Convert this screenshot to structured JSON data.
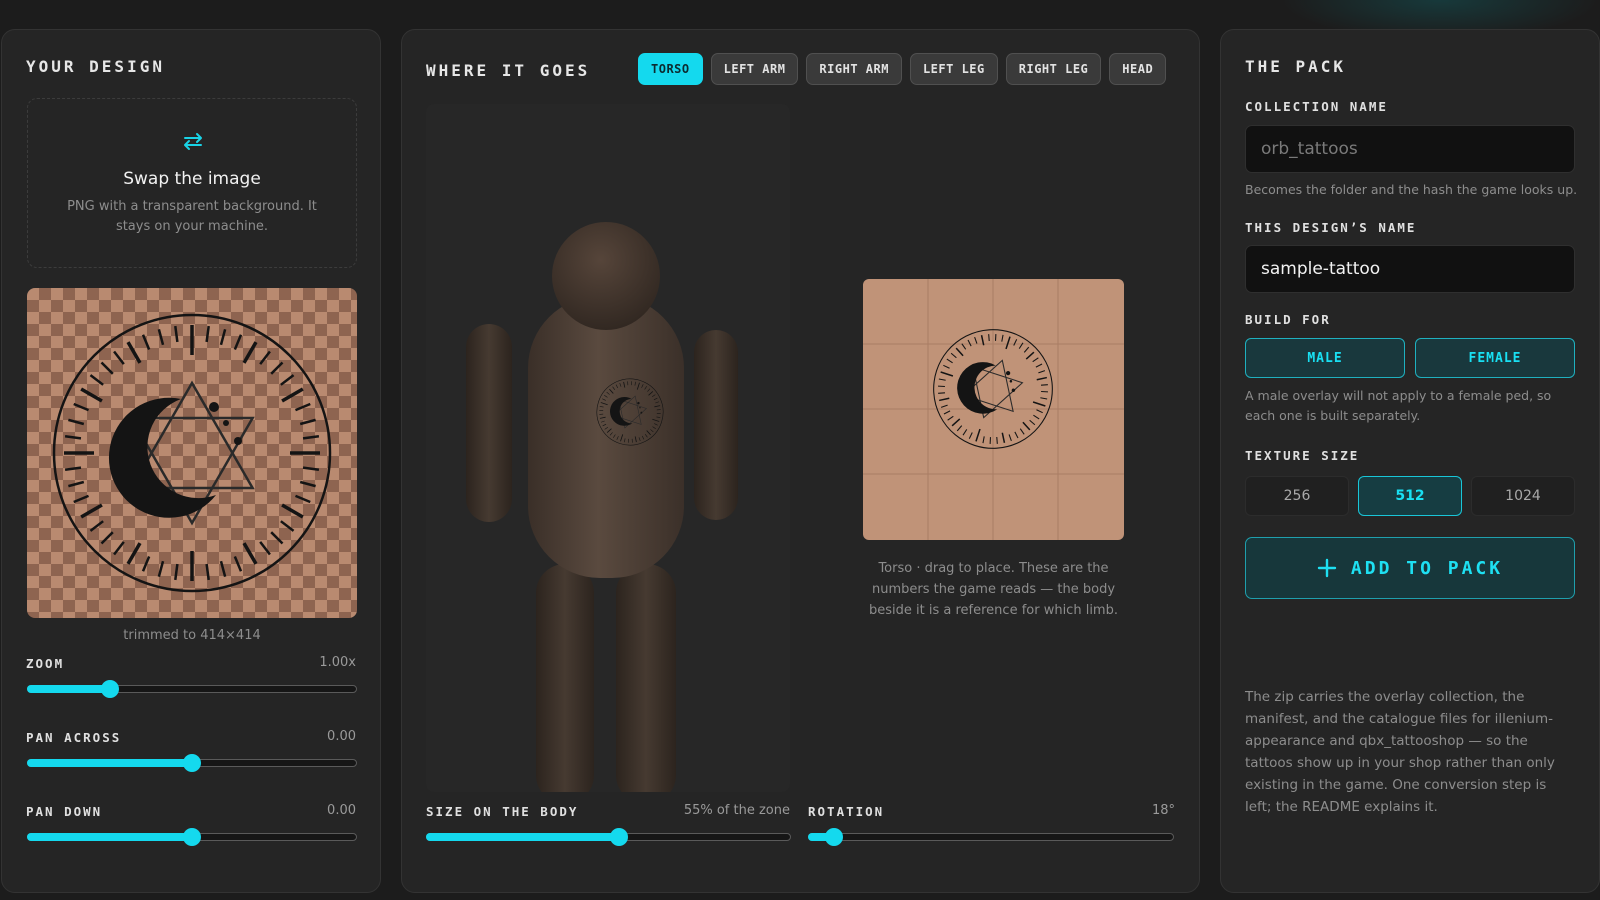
{
  "design": {
    "title": "YOUR DESIGN",
    "swap_title": "Swap the image",
    "swap_desc": "PNG with a transparent background. It stays on your machine.",
    "trim_text": "trimmed to 414×414",
    "zoom": {
      "label": "ZOOM",
      "value_text": "1.00x",
      "fraction": 0.25
    },
    "pan_across": {
      "label": "PAN ACROSS",
      "value_text": "0.00",
      "fraction": 0.5
    },
    "pan_down": {
      "label": "PAN DOWN",
      "value_text": "0.00",
      "fraction": 0.5
    }
  },
  "where": {
    "title": "WHERE IT GOES",
    "tabs": [
      "TORSO",
      "LEFT ARM",
      "RIGHT ARM",
      "LEFT LEG",
      "RIGHT LEG",
      "HEAD"
    ],
    "active_tab": "TORSO",
    "caption": "Torso · drag to place. These are the numbers the game reads — the body beside it is a reference for which limb.",
    "size": {
      "label": "SIZE ON THE BODY",
      "value_text": "55% of the zone",
      "fraction": 0.53
    },
    "rotation": {
      "label": "ROTATION",
      "value_text": "18°",
      "fraction": 0.07
    }
  },
  "pack": {
    "title": "THE PACK",
    "collection_label": "COLLECTION NAME",
    "collection_placeholder": "orb_tattoos",
    "collection_hint": "Becomes the folder and the hash the game looks up.",
    "design_name_label": "THIS DESIGN’S NAME",
    "design_name_value": "sample-tattoo",
    "build_label": "BUILD FOR",
    "male_label": "MALE",
    "female_label": "FEMALE",
    "build_hint": "A male overlay will not apply to a female ped, so each one is built separately.",
    "texture_label": "TEXTURE SIZE",
    "texture_options": [
      "256",
      "512",
      "1024"
    ],
    "texture_selected": "512",
    "add_label": "ADD TO PACK",
    "footer_text": "The zip carries the overlay collection, the manifest, and the catalogue files for illenium-appearance and qbx_tattooshop — so the tattoos show up in your shop rather than only existing in the game. One conversion step is left; the README explains it."
  },
  "colors": {
    "accent": "#14d9ee",
    "panel": "#252525",
    "background": "#1c1c1c",
    "skin": "#c09378"
  },
  "icons": {
    "swap": "swap-arrows-icon",
    "add": "plus-icon"
  }
}
